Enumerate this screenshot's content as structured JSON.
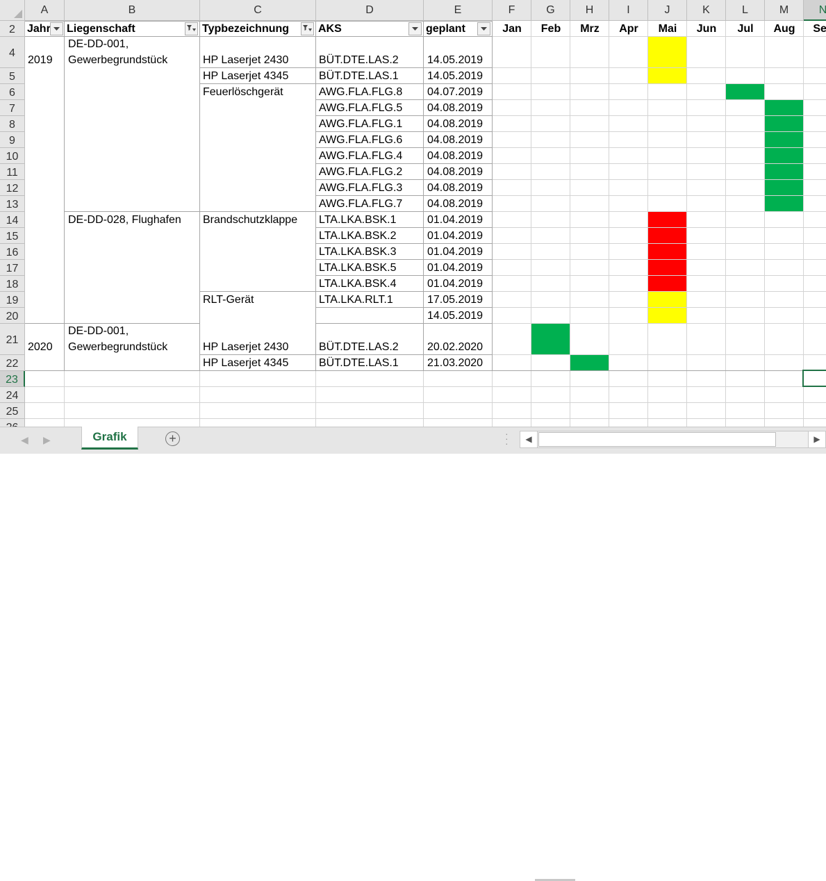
{
  "colors": {
    "yellow": "#ffff00",
    "green": "#00b050",
    "red": "#ff0000",
    "accent": "#217346"
  },
  "columns": [
    "A",
    "B",
    "C",
    "D",
    "E",
    "F",
    "G",
    "H",
    "I",
    "J",
    "K",
    "L",
    "M",
    "N"
  ],
  "selected_column": "N",
  "rows": [
    "2",
    "4",
    "5",
    "6",
    "7",
    "8",
    "9",
    "10",
    "11",
    "12",
    "13",
    "14",
    "15",
    "16",
    "17",
    "18",
    "19",
    "20",
    "21",
    "22",
    "23",
    "24",
    "25",
    "26"
  ],
  "selected_row": "23",
  "pivot_headers": {
    "year": "Jahr",
    "property": "Liegenschaft",
    "type": "Typbezeichnung",
    "aks": "AKS",
    "planned": "geplant"
  },
  "months": [
    "Jan",
    "Feb",
    "Mrz",
    "Apr",
    "Mai",
    "Jun",
    "Jul",
    "Aug",
    "Sep"
  ],
  "groups": {
    "year_2019": "2019",
    "year_2020": "2020",
    "prop_001_line1": "DE-DD-001,",
    "prop_001_line2": "Gewerbegrundstück",
    "prop_028": "DE-DD-028, Flughafen",
    "prop_001b_line1": "DE-DD-001,",
    "prop_001b_line2": "Gewerbegrundstück",
    "type_hp2430": "HP Laserjet 2430",
    "type_hp4345": "HP Laserjet 4345",
    "type_feuer": "Feuerlöschgerät",
    "type_bsk": "Brandschutzklappe",
    "type_rlt": "RLT-Gerät",
    "type_hp2430b": "HP Laserjet 2430",
    "type_hp4345b": "HP Laserjet 4345"
  },
  "data_rows": [
    {
      "row": "4",
      "aks": "BÜT.DTE.LAS.2",
      "date": "14.05.2019",
      "month_index": 4,
      "color": "yellow"
    },
    {
      "row": "5",
      "aks": "BÜT.DTE.LAS.1",
      "date": "14.05.2019",
      "month_index": 4,
      "color": "yellow"
    },
    {
      "row": "6",
      "aks": "AWG.FLA.FLG.8",
      "date": "04.07.2019",
      "month_index": 6,
      "color": "green"
    },
    {
      "row": "7",
      "aks": "AWG.FLA.FLG.5",
      "date": "04.08.2019",
      "month_index": 7,
      "color": "green"
    },
    {
      "row": "8",
      "aks": "AWG.FLA.FLG.1",
      "date": "04.08.2019",
      "month_index": 7,
      "color": "green"
    },
    {
      "row": "9",
      "aks": "AWG.FLA.FLG.6",
      "date": "04.08.2019",
      "month_index": 7,
      "color": "green"
    },
    {
      "row": "10",
      "aks": "AWG.FLA.FLG.4",
      "date": "04.08.2019",
      "month_index": 7,
      "color": "green"
    },
    {
      "row": "11",
      "aks": "AWG.FLA.FLG.2",
      "date": "04.08.2019",
      "month_index": 7,
      "color": "green"
    },
    {
      "row": "12",
      "aks": "AWG.FLA.FLG.3",
      "date": "04.08.2019",
      "month_index": 7,
      "color": "green"
    },
    {
      "row": "13",
      "aks": "AWG.FLA.FLG.7",
      "date": "04.08.2019",
      "month_index": 7,
      "color": "green"
    },
    {
      "row": "14",
      "aks": "LTA.LKA.BSK.1",
      "date": "01.04.2019",
      "month_index": 4,
      "color": "red"
    },
    {
      "row": "15",
      "aks": "LTA.LKA.BSK.2",
      "date": "01.04.2019",
      "month_index": 4,
      "color": "red"
    },
    {
      "row": "16",
      "aks": "LTA.LKA.BSK.3",
      "date": "01.04.2019",
      "month_index": 4,
      "color": "red"
    },
    {
      "row": "17",
      "aks": "LTA.LKA.BSK.5",
      "date": "01.04.2019",
      "month_index": 4,
      "color": "red"
    },
    {
      "row": "18",
      "aks": "LTA.LKA.BSK.4",
      "date": "01.04.2019",
      "month_index": 4,
      "color": "red"
    },
    {
      "row": "19",
      "aks": "LTA.LKA.RLT.1",
      "date": "17.05.2019",
      "month_index": 4,
      "color": "yellow"
    },
    {
      "row": "20",
      "aks": "",
      "date": "14.05.2019",
      "month_index": 4,
      "color": "yellow"
    },
    {
      "row": "21",
      "aks": "BÜT.DTE.LAS.2",
      "date": "20.02.2020",
      "month_index": 1,
      "color": "green"
    },
    {
      "row": "22",
      "aks": "BÜT.DTE.LAS.1",
      "date": "21.03.2020",
      "month_index": 2,
      "color": "green"
    }
  ],
  "tabs": {
    "sheet_name": "Grafik",
    "add_sheet": "+"
  },
  "icons": {
    "filter_dropdown": "chevron-down-icon",
    "filter_active": "filter-icon",
    "nav_prev": "◀",
    "nav_next": "▶"
  }
}
